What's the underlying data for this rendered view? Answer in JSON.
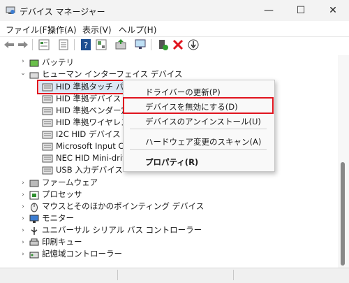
{
  "window": {
    "title": "デバイス マネージャー",
    "minimize_glyph": "—",
    "maximize_glyph": "☐",
    "close_glyph": "✕"
  },
  "menu": {
    "file": "ファイル(F)",
    "action": "操作(A)",
    "view": "表示(V)",
    "help": "ヘルプ(H)"
  },
  "toolbar": {
    "icons": [
      "back-arrow-icon",
      "forward-arrow-icon",
      "properties-icon",
      "device-list-icon",
      "help-icon",
      "view-icon",
      "update-driver-icon",
      "monitor-icon",
      "add-driver-icon",
      "uninstall-icon",
      "download-icon"
    ]
  },
  "tree": {
    "battery": "バッテリ",
    "hid": "ヒューマン インターフェイス デバイス",
    "hid_children": [
      "HID 準拠タッチ パッド",
      "HID 準拠デバイス",
      "HID 準拠ベンダー定義",
      "HID 準拠ワイヤレス無",
      "I2C HID デバイス",
      "Microsoft Input Cor",
      "NEC HID Mini-drive",
      "USB 入力デバイス"
    ],
    "after": [
      "ファームウェア",
      "プロセッサ",
      "マウスとそのほかのポインティング デバイス",
      "モニター",
      "ユニバーサル シリアル バス コントローラー",
      "印刷キュー",
      "記憶域コントローラー"
    ]
  },
  "context_menu": {
    "update_driver": "ドライバーの更新(P)",
    "disable_device": "デバイスを無効にする(D)",
    "uninstall_device": "デバイスのアンインストール(U)",
    "scan_hardware": "ハードウェア変更のスキャン(A)",
    "properties": "プロパティ(R)"
  },
  "colors": {
    "highlight_red": "#e0141e",
    "selection_blue": "#dce8f5",
    "accent_blue": "#1d4f91"
  }
}
